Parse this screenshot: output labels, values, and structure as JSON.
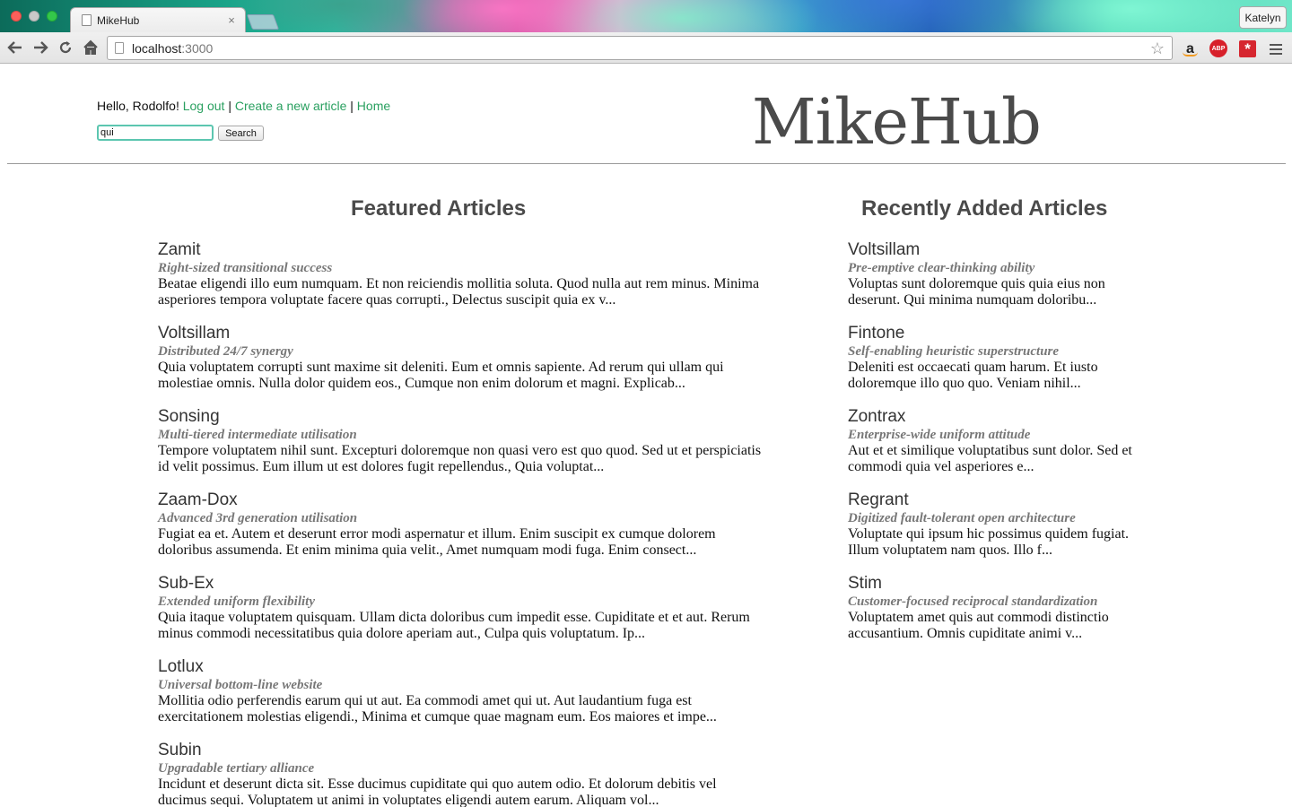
{
  "browser": {
    "tab_title": "MikeHub",
    "tab_close": "×",
    "profile_name": "Katelyn",
    "url_host": "localhost",
    "url_port": ":3000",
    "icons": [
      "back-arrow-icon",
      "forward-arrow-icon",
      "reload-icon",
      "home-icon",
      "bookmark-star-icon",
      "amazon-icon",
      "adblock-plus-icon",
      "lastpass-icon",
      "menu-icon"
    ],
    "ext_amazon": "a",
    "ext_abp": "ABP",
    "ext_lastpass": "*"
  },
  "header": {
    "greeting": "Hello, Rodolfo!",
    "logout_label": "Log out",
    "create_label": "Create a new article",
    "home_label": "Home",
    "separator": "|",
    "search_value": "qui",
    "search_button": "Search",
    "logo": "MikeHub",
    "link_color": "#2aa060"
  },
  "featured": {
    "title": "Featured Articles",
    "articles": [
      {
        "name": "Zamit",
        "tagline": "Right-sized transitional success",
        "excerpt": "Beatae eligendi illo eum numquam. Et non reiciendis mollitia soluta. Quod nulla aut rem minus. Minima asperiores tempora voluptate facere quas corrupti., Delectus suscipit quia ex v..."
      },
      {
        "name": "Voltsillam",
        "tagline": "Distributed 24/7 synergy",
        "excerpt": "Quia voluptatem corrupti sunt maxime sit deleniti. Eum et omnis sapiente. Ad rerum qui ullam qui molestiae omnis. Nulla dolor quidem eos., Cumque non enim dolorum et magni. Explicab..."
      },
      {
        "name": "Sonsing",
        "tagline": "Multi-tiered intermediate utilisation",
        "excerpt": "Tempore voluptatem nihil sunt. Excepturi doloremque non quasi vero est quo quod. Sed ut et perspiciatis id velit possimus. Eum illum ut est dolores fugit repellendus., Quia voluptat..."
      },
      {
        "name": "Zaam-Dox",
        "tagline": "Advanced 3rd generation utilisation",
        "excerpt": "Fugiat ea et. Autem et deserunt error modi aspernatur et illum. Enim suscipit ex cumque dolorem doloribus assumenda. Et enim minima quia velit., Amet numquam modi fuga. Enim consect..."
      },
      {
        "name": "Sub-Ex",
        "tagline": "Extended uniform flexibility",
        "excerpt": "Quia itaque voluptatem quisquam. Ullam dicta doloribus cum impedit esse. Cupiditate et et aut. Rerum minus commodi necessitatibus quia dolore aperiam aut., Culpa quis voluptatum. Ip..."
      },
      {
        "name": "Lotlux",
        "tagline": "Universal bottom-line website",
        "excerpt": "Mollitia odio perferendis earum qui ut aut. Ea commodi amet qui ut. Aut laudantium fuga est exercitationem molestias eligendi., Minima et cumque quae magnam eum. Eos maiores et impe..."
      },
      {
        "name": "Subin",
        "tagline": "Upgradable tertiary alliance",
        "excerpt": "Incidunt et deserunt dicta sit. Esse ducimus cupiditate qui quo autem odio. Et dolorum debitis vel ducimus sequi. Voluptatem ut animi in voluptates eligendi autem earum. Aliquam vol..."
      }
    ]
  },
  "recent": {
    "title": "Recently Added Articles",
    "articles": [
      {
        "name": "Voltsillam",
        "tagline": "Pre-emptive clear-thinking ability",
        "excerpt": "Voluptas sunt doloremque quis quia eius non deserunt. Qui minima numquam doloribu..."
      },
      {
        "name": "Fintone",
        "tagline": "Self-enabling heuristic superstructure",
        "excerpt": "Deleniti est occaecati quam harum. Et iusto doloremque illo quo quo. Veniam nihil..."
      },
      {
        "name": "Zontrax",
        "tagline": "Enterprise-wide uniform attitude",
        "excerpt": "Aut et et similique voluptatibus sunt dolor. Sed et commodi quia vel asperiores e..."
      },
      {
        "name": "Regrant",
        "tagline": "Digitized fault-tolerant open architecture",
        "excerpt": "Voluptate qui ipsum hic possimus quidem fugiat. Illum voluptatem nam quos. Illo f..."
      },
      {
        "name": "Stim",
        "tagline": "Customer-focused reciprocal standardization",
        "excerpt": "Voluptatem amet quis aut commodi distinctio accusantium. Omnis cupiditate animi v..."
      }
    ]
  }
}
